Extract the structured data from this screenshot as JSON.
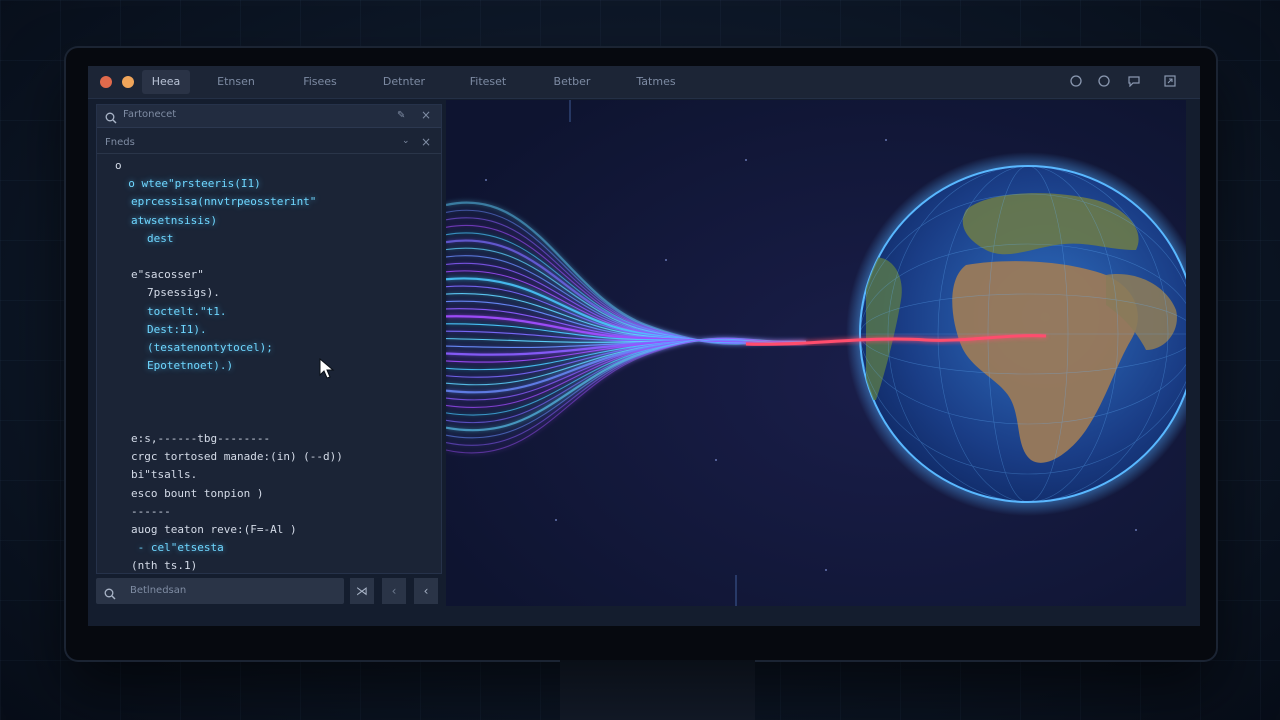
{
  "window": {
    "tabs": [
      "Heea",
      "Etnsen",
      "Fisees",
      "Detnter",
      "Fiteset",
      "Betber",
      "Tatmes"
    ]
  },
  "left_panel": {
    "search_label": "Fartonecet",
    "section_label": "Fneds",
    "code_lines": [
      {
        "indent": 0,
        "text": "o",
        "style": "c2"
      },
      {
        "indent": 0,
        "text": "  o wtee\"prsteeris(I1)",
        "style": "c1"
      },
      {
        "indent": 1,
        "text": "eprcessisa(nnvtrpeossterint\"",
        "style": "c1"
      },
      {
        "indent": 1,
        "text": "atwsetnsisis)",
        "style": "c1"
      },
      {
        "indent": 2,
        "text": "dest",
        "style": "c1"
      },
      {
        "indent": 0,
        "text": "",
        "style": "c2"
      },
      {
        "indent": 1,
        "text": "e\"sacosser\"",
        "style": "c2"
      },
      {
        "indent": 2,
        "text": "7psessigs).",
        "style": "c2"
      },
      {
        "indent": 2,
        "text": "toctelt.\"t1.",
        "style": "c1"
      },
      {
        "indent": 2,
        "text": "Dest:I1).",
        "style": "c1"
      },
      {
        "indent": 2,
        "text": "(tesatenontytocel);",
        "style": "c1"
      },
      {
        "indent": 2,
        "text": "Epotetnoet).)",
        "style": "c1"
      },
      {
        "indent": 0,
        "text": "",
        "style": "c2"
      },
      {
        "indent": 0,
        "text": "",
        "style": "c2"
      },
      {
        "indent": 0,
        "text": "",
        "style": "c2"
      },
      {
        "indent": 1,
        "text": "e:s,------tbg--------",
        "style": "c2"
      },
      {
        "indent": 1,
        "text": "crgc tortosed manade:(in) (--d))",
        "style": "c2"
      },
      {
        "indent": 1,
        "text": "bi\"tsalls.",
        "style": "c2"
      },
      {
        "indent": 1,
        "text": "esco bount tonpion )",
        "style": "c2"
      },
      {
        "indent": 1,
        "text": "------",
        "style": "c2"
      },
      {
        "indent": 1,
        "text": "auog teaton reve:(F=-Al )",
        "style": "c2"
      },
      {
        "indent": 1,
        "text": " - cel\"etsesta",
        "style": "c1"
      },
      {
        "indent": 1,
        "text": "(nth ts.1)",
        "style": "c2"
      }
    ],
    "bottom_input": "Betlnedsan"
  },
  "colors": {
    "accent_cyan": "#5fd3ff",
    "accent_purple": "#a04dff",
    "accent_red": "#ff4d6d"
  }
}
